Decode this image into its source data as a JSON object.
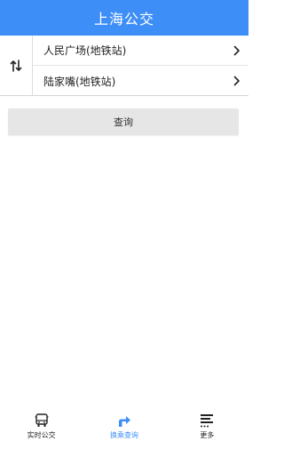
{
  "app": {
    "title": "上海公交"
  },
  "colors": {
    "primary": "#3e8ef7",
    "tab_inactive": "#222222"
  },
  "route": {
    "swap_icon": "swap-vertical-icon",
    "origin": "人民广场(地铁站)",
    "destination": "陆家嘴(地铁站)"
  },
  "query_button": {
    "label": "查询"
  },
  "tabs": [
    {
      "label": "实时公交",
      "icon": "bus-icon",
      "active": false
    },
    {
      "label": "换乘查询",
      "icon": "turn-arrow-icon",
      "active": true
    },
    {
      "label": "更多",
      "icon": "menu-more-icon",
      "active": false
    }
  ]
}
